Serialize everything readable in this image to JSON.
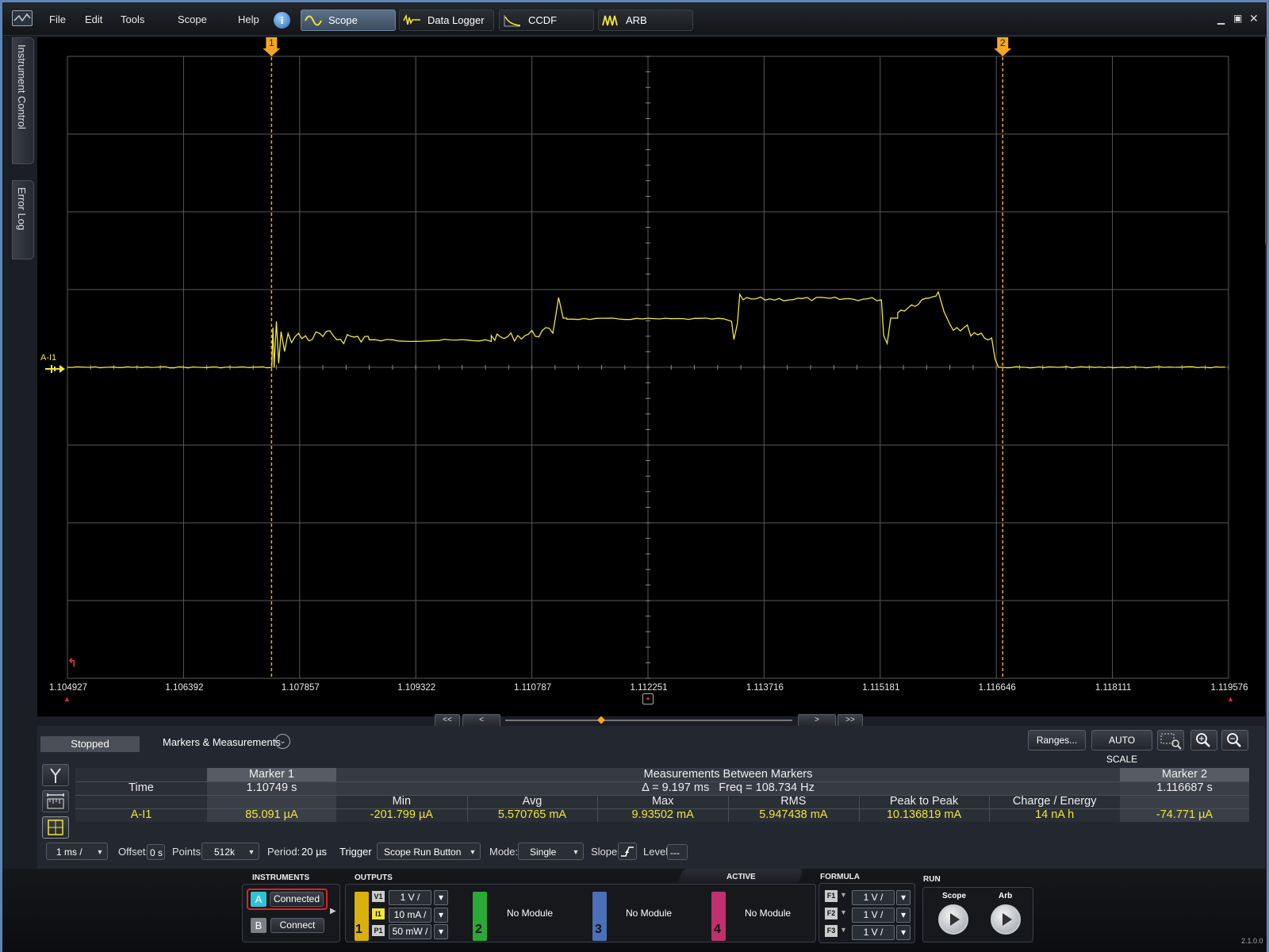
{
  "menu": {
    "file": "File",
    "edit": "Edit",
    "tools": "Tools",
    "scope": "Scope",
    "help": "Help"
  },
  "tabs": {
    "scope": "Scope",
    "logger": "Data Logger",
    "ccdf": "CCDF",
    "arb": "ARB"
  },
  "side_tabs": {
    "instrument_control": "Instrument Control",
    "error_log": "Error Log"
  },
  "plot": {
    "channel_label": "A-I1",
    "marker1_label": "1",
    "marker2_label": "2",
    "x_ticks": [
      "1.104927",
      "1.106392",
      "1.107857",
      "1.109322",
      "1.110787",
      "1.112251",
      "1.113716",
      "1.115181",
      "1.116646",
      "1.118111",
      "1.119576"
    ],
    "trace_color": "#f0e63c",
    "marker_color": "#f5a623",
    "grid_color": "#5a5a5a"
  },
  "status": {
    "state": "Stopped",
    "markers_measurements": "Markers & Measurements"
  },
  "toolbar": {
    "ranges": "Ranges...",
    "autoscale": "AUTO SCALE"
  },
  "measurements": {
    "marker1_header": "Marker 1",
    "between_header": "Measurements Between Markers",
    "marker2_header": "Marker 2",
    "time_label": "Time",
    "marker1_time": "1.10749 s",
    "delta": "Δ = 9.197 ms   Freq = 108.734 Hz",
    "marker2_time": "1.116687 s",
    "columns": [
      "Min",
      "Avg",
      "Max",
      "RMS",
      "Peak to Peak",
      "Charge / Energy"
    ],
    "row_label": "A-I1",
    "marker1_value": "85.091 µA",
    "values": [
      "-201.799 µA",
      "5.570765 mA",
      "9.93502 mA",
      "5.947438 mA",
      "10.136819 mA",
      "14 nA h"
    ],
    "marker2_value": "-74.771 µA"
  },
  "controls": {
    "timebase": "1 ms /",
    "offset_label": "Offset:",
    "offset": "0 s",
    "points_label": "Points:",
    "points": "512k",
    "period_label": "Period:",
    "period": "20 µs",
    "trigger_label": "Trigger",
    "trigger": "Scope Run Button",
    "mode_label": "Mode:",
    "mode": "Single",
    "slope_label": "Slope:",
    "level_label": "Level:",
    "level": "---"
  },
  "bottom": {
    "instruments": "INSTRUMENTS",
    "outputs": "OUTPUTS",
    "active": "ACTIVE",
    "formula": "FORMULA",
    "run": "RUN",
    "inst_a": "A",
    "inst_a_status": "Connected",
    "inst_b": "B",
    "inst_b_status": "Connect",
    "out1": {
      "num": "1",
      "v1": "V1",
      "v1_val": "1 V /",
      "i1": "I1",
      "i1_val": "10 mA /",
      "p1": "P1",
      "p1_val": "50 mW /"
    },
    "out2": {
      "num": "2",
      "text": "No Module"
    },
    "out3": {
      "num": "3",
      "text": "No Module"
    },
    "out4": {
      "num": "4",
      "text": "No Module"
    },
    "formulas": [
      {
        "name": "F1",
        "val": "1 V /"
      },
      {
        "name": "F2",
        "val": "1 V /"
      },
      {
        "name": "F3",
        "val": "1 V /"
      }
    ],
    "run_scope": "Scope",
    "run_arb": "Arb",
    "version": "2.1.0.0"
  }
}
